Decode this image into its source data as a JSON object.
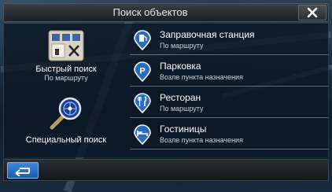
{
  "header": {
    "title": "Поиск объектов",
    "close_icon": "close-icon"
  },
  "left_panel": {
    "quick_search": {
      "label": "Быстрый поиск",
      "sublabel": "По маршруту",
      "icon": "keyboard-icon"
    },
    "special_search": {
      "label": "Специальный поиск",
      "icon": "magnifier-globe-icon"
    }
  },
  "categories": [
    {
      "label": "Заправочная станция",
      "sublabel": "По маршруту",
      "icon": "fuel-pump-icon"
    },
    {
      "label": "Парковка",
      "sublabel": "Возле пункта назначения",
      "icon": "parking-icon"
    },
    {
      "label": "Ресторан",
      "sublabel": "По маршруту",
      "icon": "restaurant-icon"
    },
    {
      "label": "Гостиницы",
      "sublabel": "Возле пункта назначения",
      "icon": "hotel-bed-icon"
    }
  ],
  "footer": {
    "back_icon": "back-arrow-icon"
  },
  "colors": {
    "accent_blue": "#2f7fd0",
    "pin_blue": "#2a6cc0",
    "title_bar": "#25292d"
  }
}
